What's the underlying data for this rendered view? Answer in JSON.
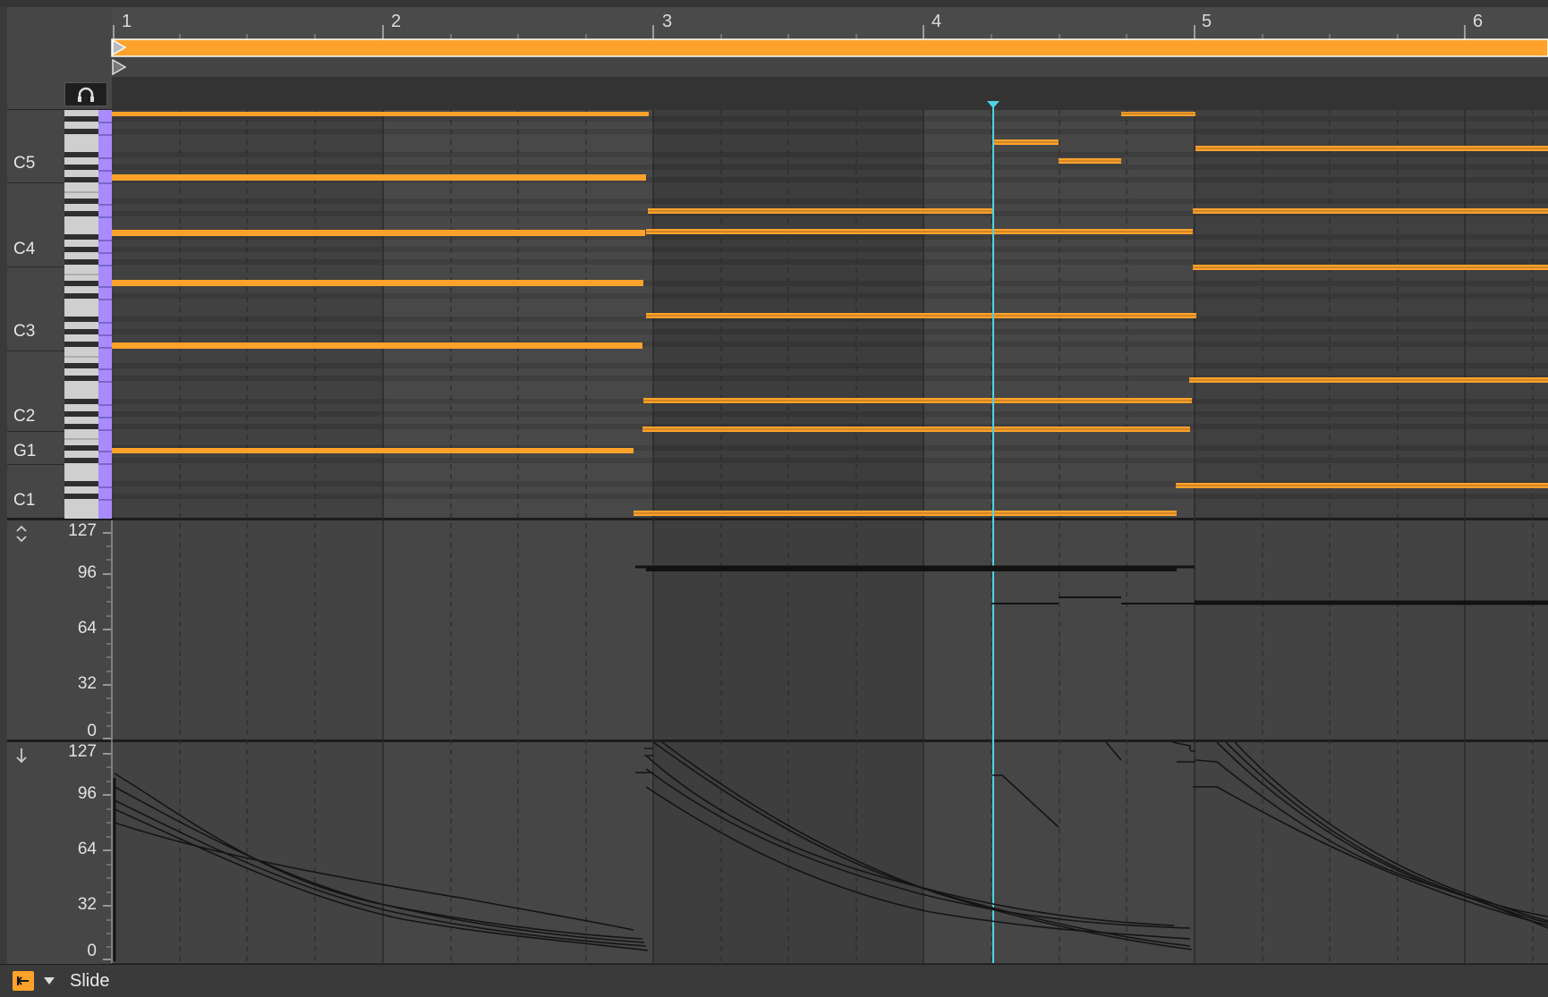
{
  "ruler": {
    "bars": [
      "1",
      "2",
      "3",
      "4",
      "5",
      "6"
    ]
  },
  "piano": {
    "labels": [
      "C5",
      "C4",
      "C3",
      "C2",
      "G1",
      "C1"
    ]
  },
  "velocity_lane": {
    "ticks": [
      "127",
      "96",
      "64",
      "32",
      "0"
    ]
  },
  "release_lane": {
    "ticks": [
      "127",
      "96",
      "64",
      "32",
      "0"
    ]
  },
  "footer": {
    "parameter": "Slide"
  },
  "colors": {
    "note": "#ffa22b",
    "playhead": "#4fd3e0",
    "key_accent": "#a98bff"
  },
  "icons": {
    "fold": "headphones-icon",
    "lane1": "up-down-arrows-icon",
    "lane2": "down-arrow-icon",
    "footer_toggle": "collapse-icon",
    "footer_menu": "triangle-down-icon"
  }
}
